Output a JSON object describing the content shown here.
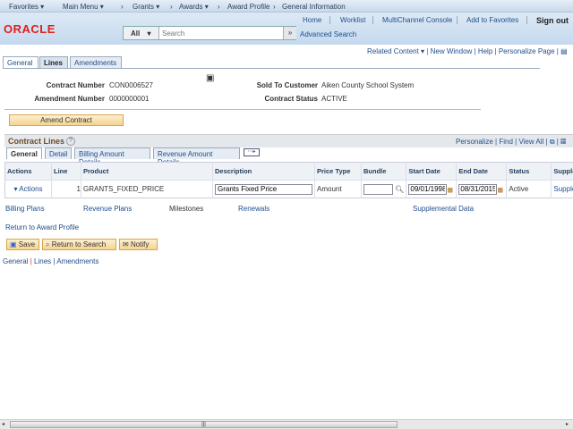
{
  "navbar": {
    "favorites": "Favorites ▾",
    "main_menu": "Main Menu ▾",
    "crumbs": [
      "Grants ▾",
      "Awards ▾",
      "Award Profile",
      "General Information"
    ]
  },
  "header": {
    "links": [
      "Home",
      "Worklist",
      "MultiChannel Console",
      "Add to Favorites"
    ],
    "sign_out": "Sign out",
    "logo": "ORACLE",
    "search_scope": "All",
    "search_placeholder": "Search",
    "advanced_search": "Advanced Search"
  },
  "toolbar": {
    "related_content": "Related Content ▾",
    "new_window": "New Window",
    "help": "Help",
    "personalize": "Personalize Page"
  },
  "page_tabs": [
    "General",
    "Lines",
    "Amendments"
  ],
  "contract": {
    "contract_number_label": "Contract Number",
    "contract_number": "CON0006527",
    "amendment_label": "Amendment Number",
    "amendment": "0000000001",
    "customer_label": "Sold To Customer",
    "customer": "Aiken County School System",
    "status_label": "Contract Status",
    "status": "ACTIVE"
  },
  "amend_button": "Amend Contract",
  "grid": {
    "title": "Contract Lines",
    "personalize": "Personalize",
    "find": "Find",
    "view_all": "View All",
    "tabs": [
      "General",
      "Detail",
      "Billing Amount Details",
      "Revenue Amount Details"
    ],
    "columns": [
      "Actions",
      "Line",
      "Product",
      "Description",
      "Price Type",
      "Bundle",
      "Start Date",
      "End Date",
      "Status",
      "Supplem"
    ],
    "rows": [
      {
        "actions": "▾ Actions",
        "line": "1",
        "product": "GRANTS_FIXED_PRICE",
        "description": "Grants Fixed Price",
        "price_type": "Amount",
        "bundle": "",
        "start_date": "09/01/1998",
        "end_date": "08/31/2015",
        "status": "Active",
        "supplemental": "Supplem"
      }
    ]
  },
  "links": {
    "billing_plans": "Billing Plans",
    "revenue_plans": "Revenue Plans",
    "milestones": "Milestones",
    "renewals": "Renewals",
    "supplemental": "Supplemental Data",
    "return_award": "Return to Award Profile"
  },
  "buttons": {
    "save": "Save",
    "return_search": "Return to Search",
    "notify": "Notify"
  },
  "footer_links": [
    "General",
    "Lines",
    "Amendments"
  ]
}
